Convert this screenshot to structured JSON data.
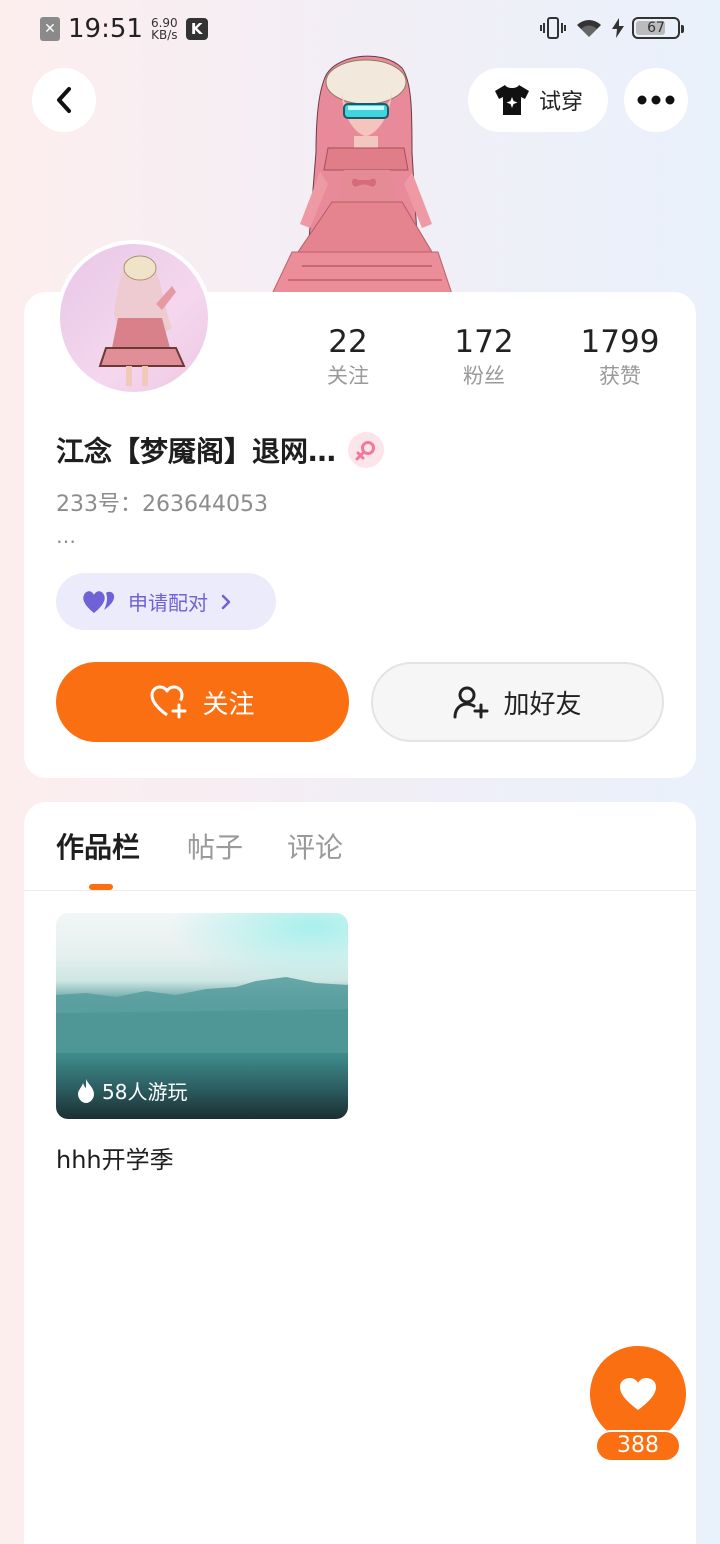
{
  "status_bar": {
    "time": "19:51",
    "speed_value": "6.90",
    "speed_unit": "KB/s",
    "battery": "67",
    "icons": [
      "close-notification-icon",
      "k-app-icon",
      "vibrate-icon",
      "wifi-icon",
      "charging-icon",
      "battery-icon"
    ]
  },
  "header": {
    "tryon_label": "试穿",
    "icons": [
      "back-chevron-icon",
      "shirt-icon",
      "more-dots-icon"
    ]
  },
  "profile": {
    "stats": [
      {
        "value": "22",
        "label": "关注"
      },
      {
        "value": "172",
        "label": "粉丝"
      },
      {
        "value": "1799",
        "label": "获赞"
      }
    ],
    "username": "江念【梦魇阁】退网…",
    "gender": "female",
    "uid": "233号：263644053",
    "bio": "…",
    "pair_label": "申请配对",
    "follow_label": "关注",
    "add_friend_label": "加好友"
  },
  "tabs": [
    {
      "label": "作品栏",
      "active": true
    },
    {
      "label": "帖子",
      "active": false
    },
    {
      "label": "评论",
      "active": false
    }
  ],
  "works": [
    {
      "play_count": "58人游玩",
      "title": "hhh开学季"
    }
  ],
  "like": {
    "count": "388"
  },
  "colors": {
    "accent": "#fa6f12",
    "pair": "#6f62d6",
    "gender": "#f07a9a"
  }
}
